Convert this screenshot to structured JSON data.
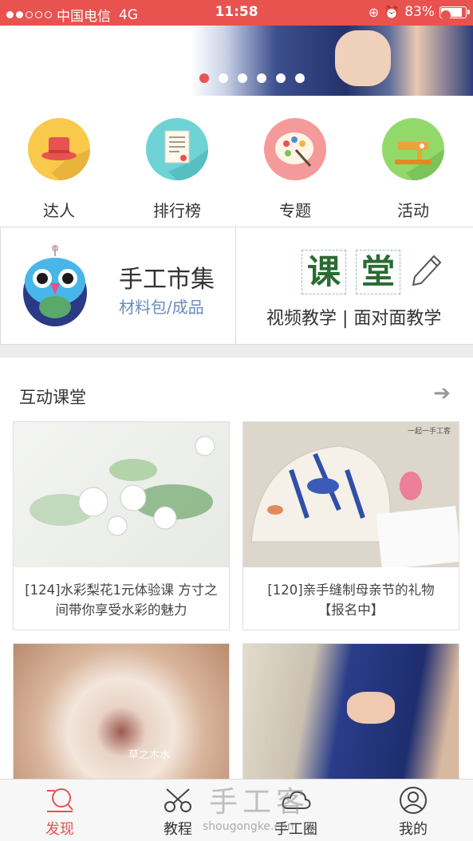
{
  "status_bar": {
    "carrier": "中国电信",
    "network": "4G",
    "time": "11:58",
    "battery": "83%",
    "battery_level": 0.83,
    "signal_bars_filled": 2,
    "signal_bars_total": 5
  },
  "banner": {
    "slide_count": 6,
    "active_slide": 1
  },
  "quick_nav": [
    {
      "label": "达人",
      "icon": "hat-icon",
      "color": "#f8c94a"
    },
    {
      "label": "排行榜",
      "icon": "document-icon",
      "color": "#6fd3d6"
    },
    {
      "label": "专题",
      "icon": "palette-icon",
      "color": "#f59a9a"
    },
    {
      "label": "活动",
      "icon": "sewing-machine-icon",
      "color": "#93d96a"
    }
  ],
  "promo": {
    "market_title": "手工市集",
    "market_subtitle": "材料包/成品",
    "class_char_1": "课",
    "class_char_2": "堂",
    "class_subtitle": "视频教学 | 面对面教学"
  },
  "section": {
    "title": "互动课堂",
    "cards": [
      {
        "caption": "[124]水彩梨花1元体验课 方寸之间带你享受水彩的魅力"
      },
      {
        "caption": "[120]亲手缝制母亲节的礼物【报名中】",
        "image_text": "一起一手工客"
      },
      {
        "caption": "",
        "image_text": "草之木水"
      },
      {
        "caption": ""
      }
    ]
  },
  "tabbar": {
    "tabs": [
      {
        "label": "发现",
        "icon": "discover-icon"
      },
      {
        "label": "教程",
        "icon": "scissors-icon"
      },
      {
        "label": "手工圈",
        "icon": "cloud-icon"
      },
      {
        "label": "我的",
        "icon": "profile-icon"
      }
    ],
    "active": 0
  },
  "watermark": {
    "brand": "手工客",
    "url": "shougongke.com"
  },
  "colors": {
    "accent": "#e8524f",
    "link": "#6a8bbf"
  }
}
